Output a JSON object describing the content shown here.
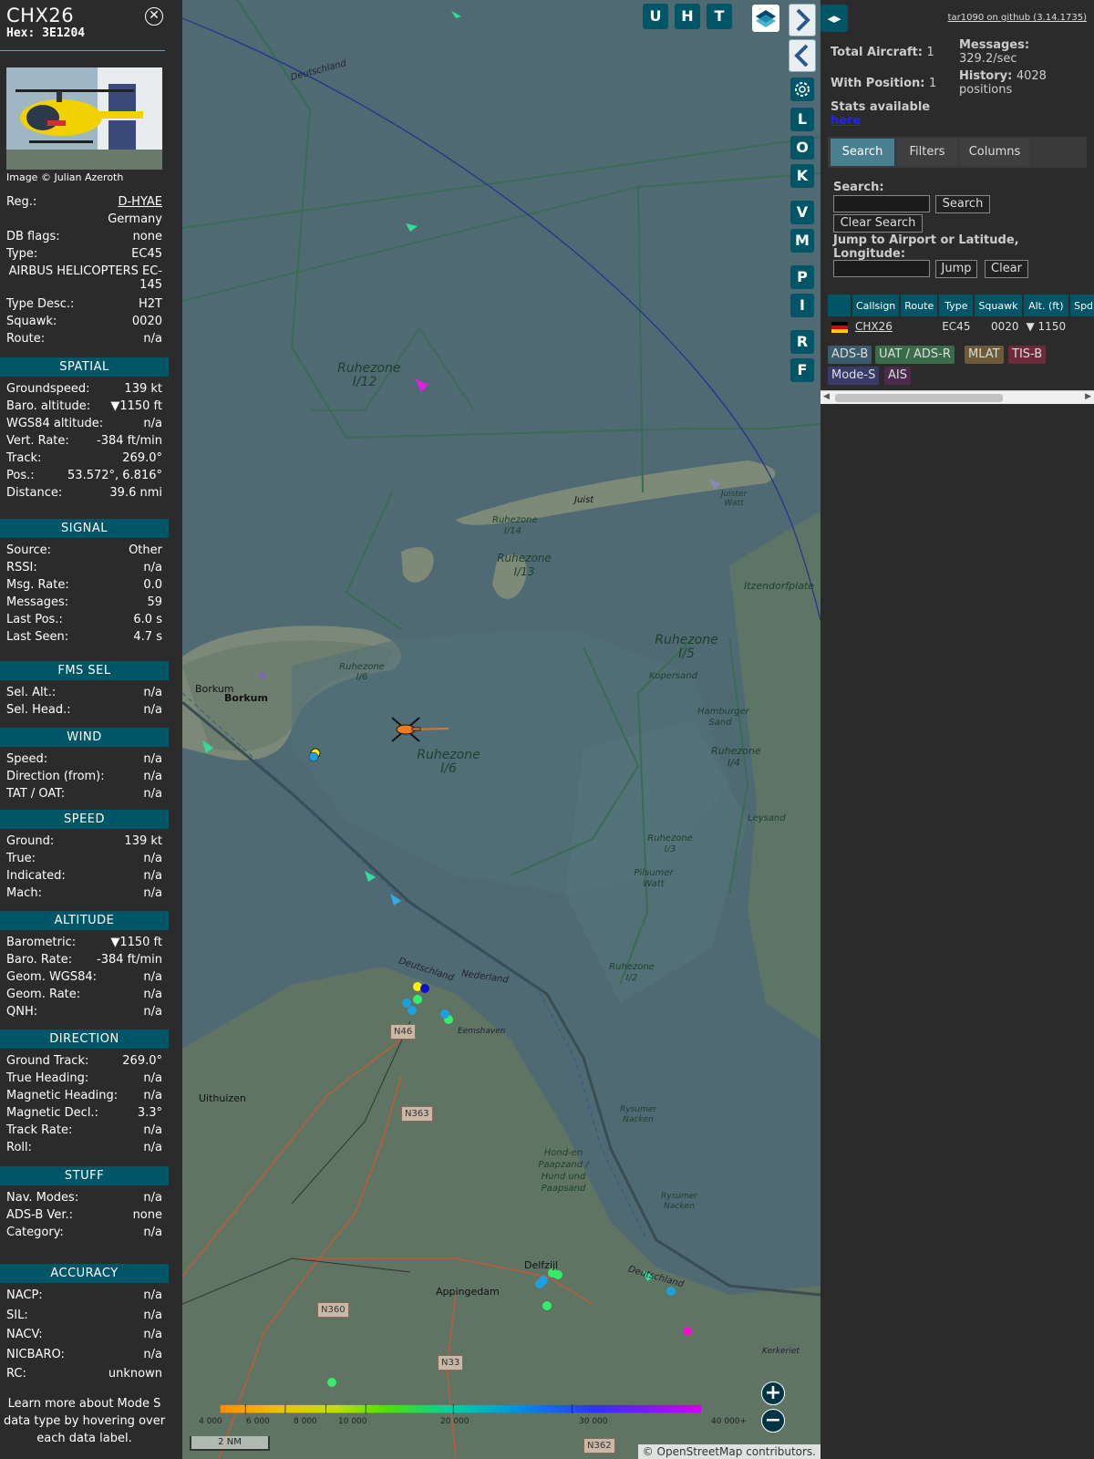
{
  "selected": {
    "callsign": "CHX26",
    "hex_label": "Hex:",
    "hex": "3E1204",
    "image_credit": "Image © Julian Azeroth",
    "info": [
      {
        "k": "Reg.:",
        "v": "D-HYAE",
        "link": true
      },
      {
        "k": "",
        "v": "Germany"
      },
      {
        "k": "DB flags:",
        "v": "none"
      },
      {
        "k": "Type:",
        "v": "EC45"
      },
      {
        "k": "",
        "v": "AIRBUS HELICOPTERS EC-145"
      },
      {
        "k": "Type Desc.:",
        "v": "H2T"
      },
      {
        "k": "Squawk:",
        "v": "0020"
      },
      {
        "k": "Route:",
        "v": "n/a"
      }
    ],
    "sections": [
      {
        "title": "SPATIAL",
        "rows": [
          {
            "k": "Groundspeed:",
            "v": "139 kt"
          },
          {
            "k": "Baro. altitude:",
            "v": "▼1150 ft"
          },
          {
            "k": "WGS84 altitude:",
            "v": "n/a"
          },
          {
            "k": "Vert. Rate:",
            "v": "-384 ft/min"
          },
          {
            "k": "Track:",
            "v": "269.0°"
          },
          {
            "k": "Pos.:",
            "v": "53.572°, 6.816°"
          },
          {
            "k": "Distance:",
            "v": "39.6 nmi"
          }
        ]
      },
      {
        "title": "SIGNAL",
        "rows": [
          {
            "k": "Source:",
            "v": "Other"
          },
          {
            "k": "RSSI:",
            "v": "n/a"
          },
          {
            "k": "Msg. Rate:",
            "v": "0.0"
          },
          {
            "k": "Messages:",
            "v": "59"
          },
          {
            "k": "Last Pos.:",
            "v": "6.0 s"
          },
          {
            "k": "Last Seen:",
            "v": "4.7 s"
          }
        ]
      },
      {
        "title": "FMS SEL",
        "rows": [
          {
            "k": "Sel. Alt.:",
            "v": "n/a"
          },
          {
            "k": "Sel. Head.:",
            "v": "n/a"
          }
        ]
      },
      {
        "title": "WIND",
        "rows": [
          {
            "k": "Speed:",
            "v": "n/a"
          },
          {
            "k": "Direction (from):",
            "v": "n/a"
          },
          {
            "k": "TAT / OAT:",
            "v": "n/a"
          }
        ]
      },
      {
        "title": "SPEED",
        "rows": [
          {
            "k": "Ground:",
            "v": "139 kt"
          },
          {
            "k": "True:",
            "v": "n/a"
          },
          {
            "k": "Indicated:",
            "v": "n/a"
          },
          {
            "k": "Mach:",
            "v": "n/a"
          }
        ]
      },
      {
        "title": "ALTITUDE",
        "rows": [
          {
            "k": "Barometric:",
            "v": "▼1150 ft"
          },
          {
            "k": "Baro. Rate:",
            "v": "-384 ft/min"
          },
          {
            "k": "Geom. WGS84:",
            "v": "n/a"
          },
          {
            "k": "Geom. Rate:",
            "v": "n/a"
          },
          {
            "k": "QNH:",
            "v": "n/a"
          }
        ]
      },
      {
        "title": "DIRECTION",
        "rows": [
          {
            "k": "Ground Track:",
            "v": "269.0°"
          },
          {
            "k": "True Heading:",
            "v": "n/a"
          },
          {
            "k": "Magnetic Heading:",
            "v": "n/a"
          },
          {
            "k": "Magnetic Decl.:",
            "v": "3.3°"
          },
          {
            "k": "Track Rate:",
            "v": "n/a"
          },
          {
            "k": "Roll:",
            "v": "n/a"
          }
        ]
      },
      {
        "title": "STUFF",
        "rows": [
          {
            "k": "Nav. Modes:",
            "v": "n/a"
          },
          {
            "k": "ADS-B Ver.:",
            "v": "none"
          },
          {
            "k": "Category:",
            "v": "n/a"
          }
        ]
      },
      {
        "title": "ACCURACY",
        "rows": [
          {
            "k": "NACP:",
            "v": "n/a"
          },
          {
            "k": "SIL:",
            "v": "n/a"
          },
          {
            "k": "NACV:",
            "v": "n/a"
          },
          {
            "k": "NICBARO:",
            "v": "n/a"
          },
          {
            "k": "RC:",
            "v": "unknown"
          }
        ]
      }
    ],
    "footer": "Learn more about Mode S data type by hovering over each data label."
  },
  "map": {
    "top_buttons": [
      "U",
      "H",
      "T"
    ],
    "side_buttons": [
      "L",
      "O",
      "K",
      "V",
      "M",
      "P",
      "I",
      "R",
      "F"
    ],
    "labels": {
      "deutschland": "Deutschland",
      "ruhezone_i12": "Ruhezone I/12",
      "juist": "Juist",
      "ruhezone_i14": "Ruhezone I/14",
      "ruhezone_i13": "Ruhezone I/13",
      "juister_watt": "Juister Watt",
      "itzendorfplate": "Itzendorfplate",
      "ruhezone_i5": "Ruhezone I/5",
      "kopersand": "Kopersand",
      "borkum": "Borkum",
      "ruhezone_i6_small": "Ruhezone I/6",
      "hamburger_sand": "Hamburger Sand",
      "ruhezone_i4": "Ruhezone I/4",
      "ruhezone_i6": "Ruhezone I/6",
      "leysand": "Leysand",
      "ruhezone_i3": "Ruhezone I/3",
      "pilsumer_watt": "Pilsumer Watt",
      "ruhezone_i2": "Ruhezone I/2",
      "deutschland2": "Deutschland",
      "nederland": "Nederland",
      "eemshaven": "Eemshaven",
      "n46": "N46",
      "uithuizen": "Uithuizen",
      "n363": "N363",
      "rysumer_nacken": "Rysumer Nacken",
      "hond_paapsand": "Hond-en Paapzand / Hund und Paapsand",
      "rysumer_nacken2": "Rysumer Nacken",
      "delfzijl": "Delfzijl",
      "appingedam": "Appingedam",
      "deutschland3": "Deutschland",
      "n360": "N360",
      "n33": "N33",
      "kerkeriet": "Kerkeriet",
      "n362": "N362"
    },
    "altitude_scale": [
      "4 000",
      "6 000",
      "8 000",
      "10 000",
      "20 000",
      "30 000",
      "40 000+"
    ],
    "scale_label": "2 NM",
    "attribution_prefix": "© ",
    "attribution_link": "OpenStreetMap",
    "attribution_suffix": " contributors."
  },
  "side": {
    "github_link": "tar1090 on github (3.14.1735)",
    "total_aircraft_label": "Total Aircraft:",
    "total_aircraft": "1",
    "messages_label": "Messages:",
    "messages": "329.2/sec",
    "with_position_label": "With Position:",
    "with_position": "1",
    "history_label": "History:",
    "history": "4028 positions",
    "stats_label": "Stats available",
    "stats_link": "here",
    "tabs": [
      "Search",
      "Filters",
      "Columns"
    ],
    "search_label": "Search:",
    "search_button": "Search",
    "clear_search_button": "Clear Search",
    "jump_label": "Jump to Airport or Latitude, Longitude:",
    "jump_button": "Jump",
    "clear_button": "Clear",
    "table_headers": [
      "Callsign",
      "Route",
      "Type",
      "Squawk",
      "Alt. (ft)",
      "Spd"
    ],
    "table_rows": [
      {
        "callsign": "CHX26",
        "route": "",
        "type": "EC45",
        "squawk": "0020",
        "alt": "▼ 1150",
        "spd": ""
      }
    ],
    "legend": [
      {
        "label": "ADS-B",
        "color": "#3b5b6b"
      },
      {
        "label": "UAT / ADS-R",
        "color": "#3b6b4b"
      },
      {
        "label": "MLAT",
        "color": "#6b5b3b"
      },
      {
        "label": "TIS-B",
        "color": "#6b2b3b"
      },
      {
        "label": "Mode-S",
        "color": "#3b3b6b"
      },
      {
        "label": "AIS",
        "color": "#4b2b4b"
      }
    ]
  },
  "colors": {
    "panel_bg": "#2b2b2b",
    "accent": "#005566",
    "map_water": "#4f6a73"
  }
}
